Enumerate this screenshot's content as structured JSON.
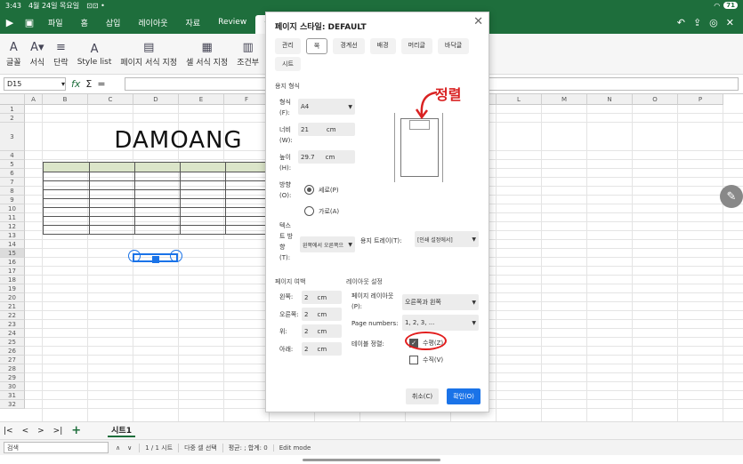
{
  "status_bar": {
    "time": "3:43",
    "date": "4월 24일 목요일",
    "battery": "71"
  },
  "menu": {
    "items": [
      "파일",
      "홈",
      "삽입",
      "레이아웃",
      "자료",
      "Review",
      "형식"
    ],
    "active": "형식"
  },
  "ribbon": {
    "buttons": [
      {
        "label": "글꼴",
        "icon": "font-icon"
      },
      {
        "label": "서식",
        "icon": "format-icon"
      },
      {
        "label": "단락",
        "icon": "paragraph-icon"
      },
      {
        "label": "Style list",
        "icon": "style-icon"
      },
      {
        "label": "페이지 서식 지정",
        "icon": "page-format-icon"
      },
      {
        "label": "셀 서식 지정",
        "icon": "cell-format-icon"
      },
      {
        "label": "조건부",
        "icon": "conditional-icon"
      }
    ]
  },
  "formula_bar": {
    "cell_ref": "D15",
    "fx": "fx",
    "sigma": "Σ",
    "equals": "="
  },
  "sheet": {
    "columns": [
      "A",
      "B",
      "C",
      "D",
      "E",
      "F",
      "G",
      "H",
      "I",
      "J",
      "K",
      "L",
      "M",
      "N",
      "O",
      "P"
    ],
    "rows": [
      "1",
      "2",
      "3",
      "4",
      "5",
      "6",
      "7",
      "8",
      "9",
      "10",
      "11",
      "12",
      "13",
      "14",
      "15",
      "16",
      "17",
      "18",
      "19",
      "20",
      "21",
      "22",
      "23",
      "24",
      "25",
      "26",
      "27",
      "28",
      "29",
      "30",
      "31",
      "32"
    ],
    "title_text": "DAMOANG"
  },
  "sheet_tabs": {
    "active": "시트1"
  },
  "bottom_bar": {
    "search_placeholder": "검색",
    "page": "1 / 1 시트",
    "select_mode": "다중 셀 선택",
    "stats": "평균: ; 합계: 0",
    "mode": "Edit mode"
  },
  "dialog": {
    "title": "페이지 스타일: DEFAULT",
    "tabs": [
      "관리",
      "쪽",
      "경계선",
      "배경",
      "머리글",
      "바닥글",
      "시트"
    ],
    "active_tab": "쪽",
    "paper_format_section": "용지 형식",
    "format_label": "형식 (F):",
    "format_value": "A4",
    "width_label": "너비 (W):",
    "width_value": "21",
    "width_unit": "cm",
    "height_label": "높이 (H):",
    "height_value": "29.7",
    "height_unit": "cm",
    "orientation_label": "방향 (O):",
    "portrait": "세로(P)",
    "landscape": "가로(A)",
    "text_direction_label": "텍스 트 방 향 (T):",
    "text_direction_value": "왼쪽에서 오른쪽으",
    "paper_tray_label": "용지 트레이(T):",
    "paper_tray_value": "[인쇄 설정에서]",
    "margins_section": "페이지 여백",
    "left_label": "왼쪽:",
    "left_value": "2",
    "right_label": "오른쪽:",
    "right_value": "2",
    "top_label": "위:",
    "top_value": "2",
    "bottom_label": "아래:",
    "bottom_value": "2",
    "margin_unit": "cm",
    "layout_section": "레이아웃 설정",
    "page_layout_label": "페이지 레이아웃 (P):",
    "page_layout_value": "오른쪽과 왼쪽",
    "page_numbers_label": "Page numbers:",
    "page_numbers_value": "1, 2, 3, ...",
    "table_align_label": "테이블 정렬:",
    "horizontal": "수평(Z)",
    "vertical": "수직(V)",
    "cancel": "취소(C)",
    "ok": "확인(O)",
    "annotation": "정렬"
  }
}
